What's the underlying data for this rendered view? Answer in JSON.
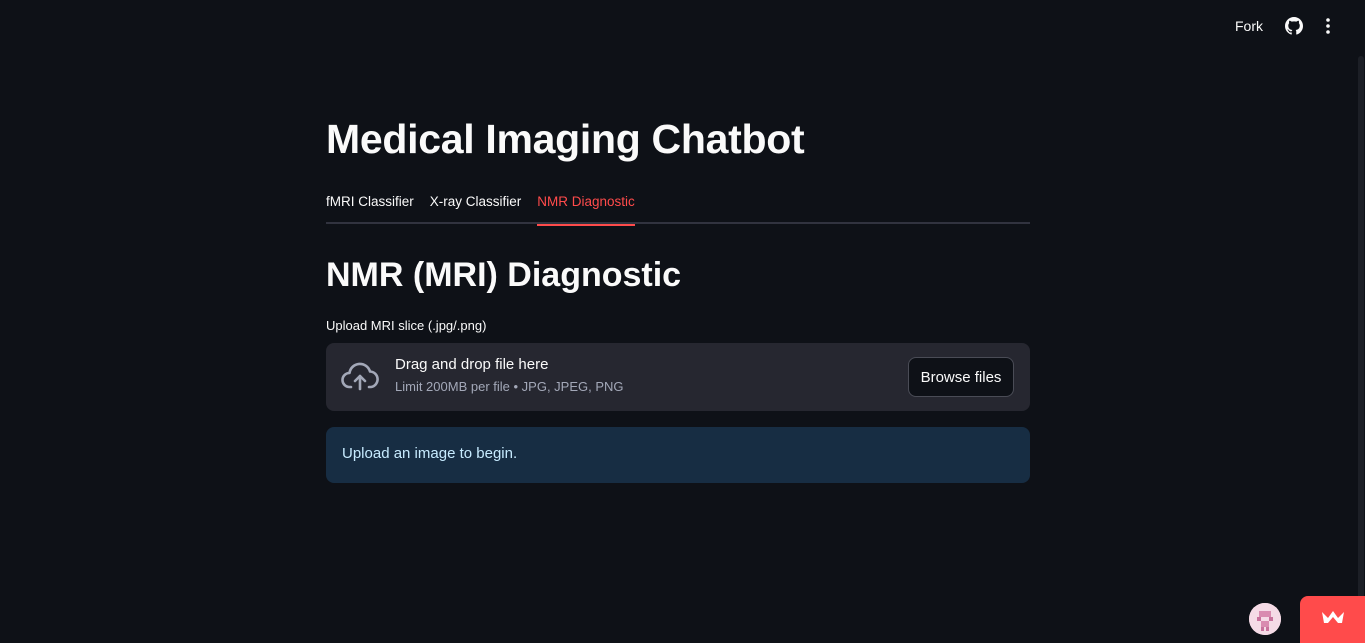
{
  "header": {
    "fork_label": "Fork",
    "icons": [
      "github-icon",
      "more-vert-icon"
    ]
  },
  "main": {
    "title": "Medical Imaging Chatbot",
    "tabs": [
      {
        "label": "fMRI Classifier",
        "active": false
      },
      {
        "label": "X-ray Classifier",
        "active": false
      },
      {
        "label": "NMR Diagnostic",
        "active": true
      }
    ],
    "section_title": "NMR (MRI) Diagnostic",
    "uploader": {
      "label": "Upload MRI slice (.jpg/.png)",
      "drop_text": "Drag and drop file here",
      "limit_text": "Limit 200MB per file • JPG, JPEG, PNG",
      "browse_label": "Browse files",
      "icon": "cloud-upload-icon"
    },
    "info": {
      "message": "Upload an image to begin."
    }
  },
  "colors": {
    "background": "#0e1117",
    "accent": "#ff4b4b",
    "info_bg": "#172d43",
    "info_text": "#c7ebff",
    "dropzone_bg": "#262730"
  }
}
